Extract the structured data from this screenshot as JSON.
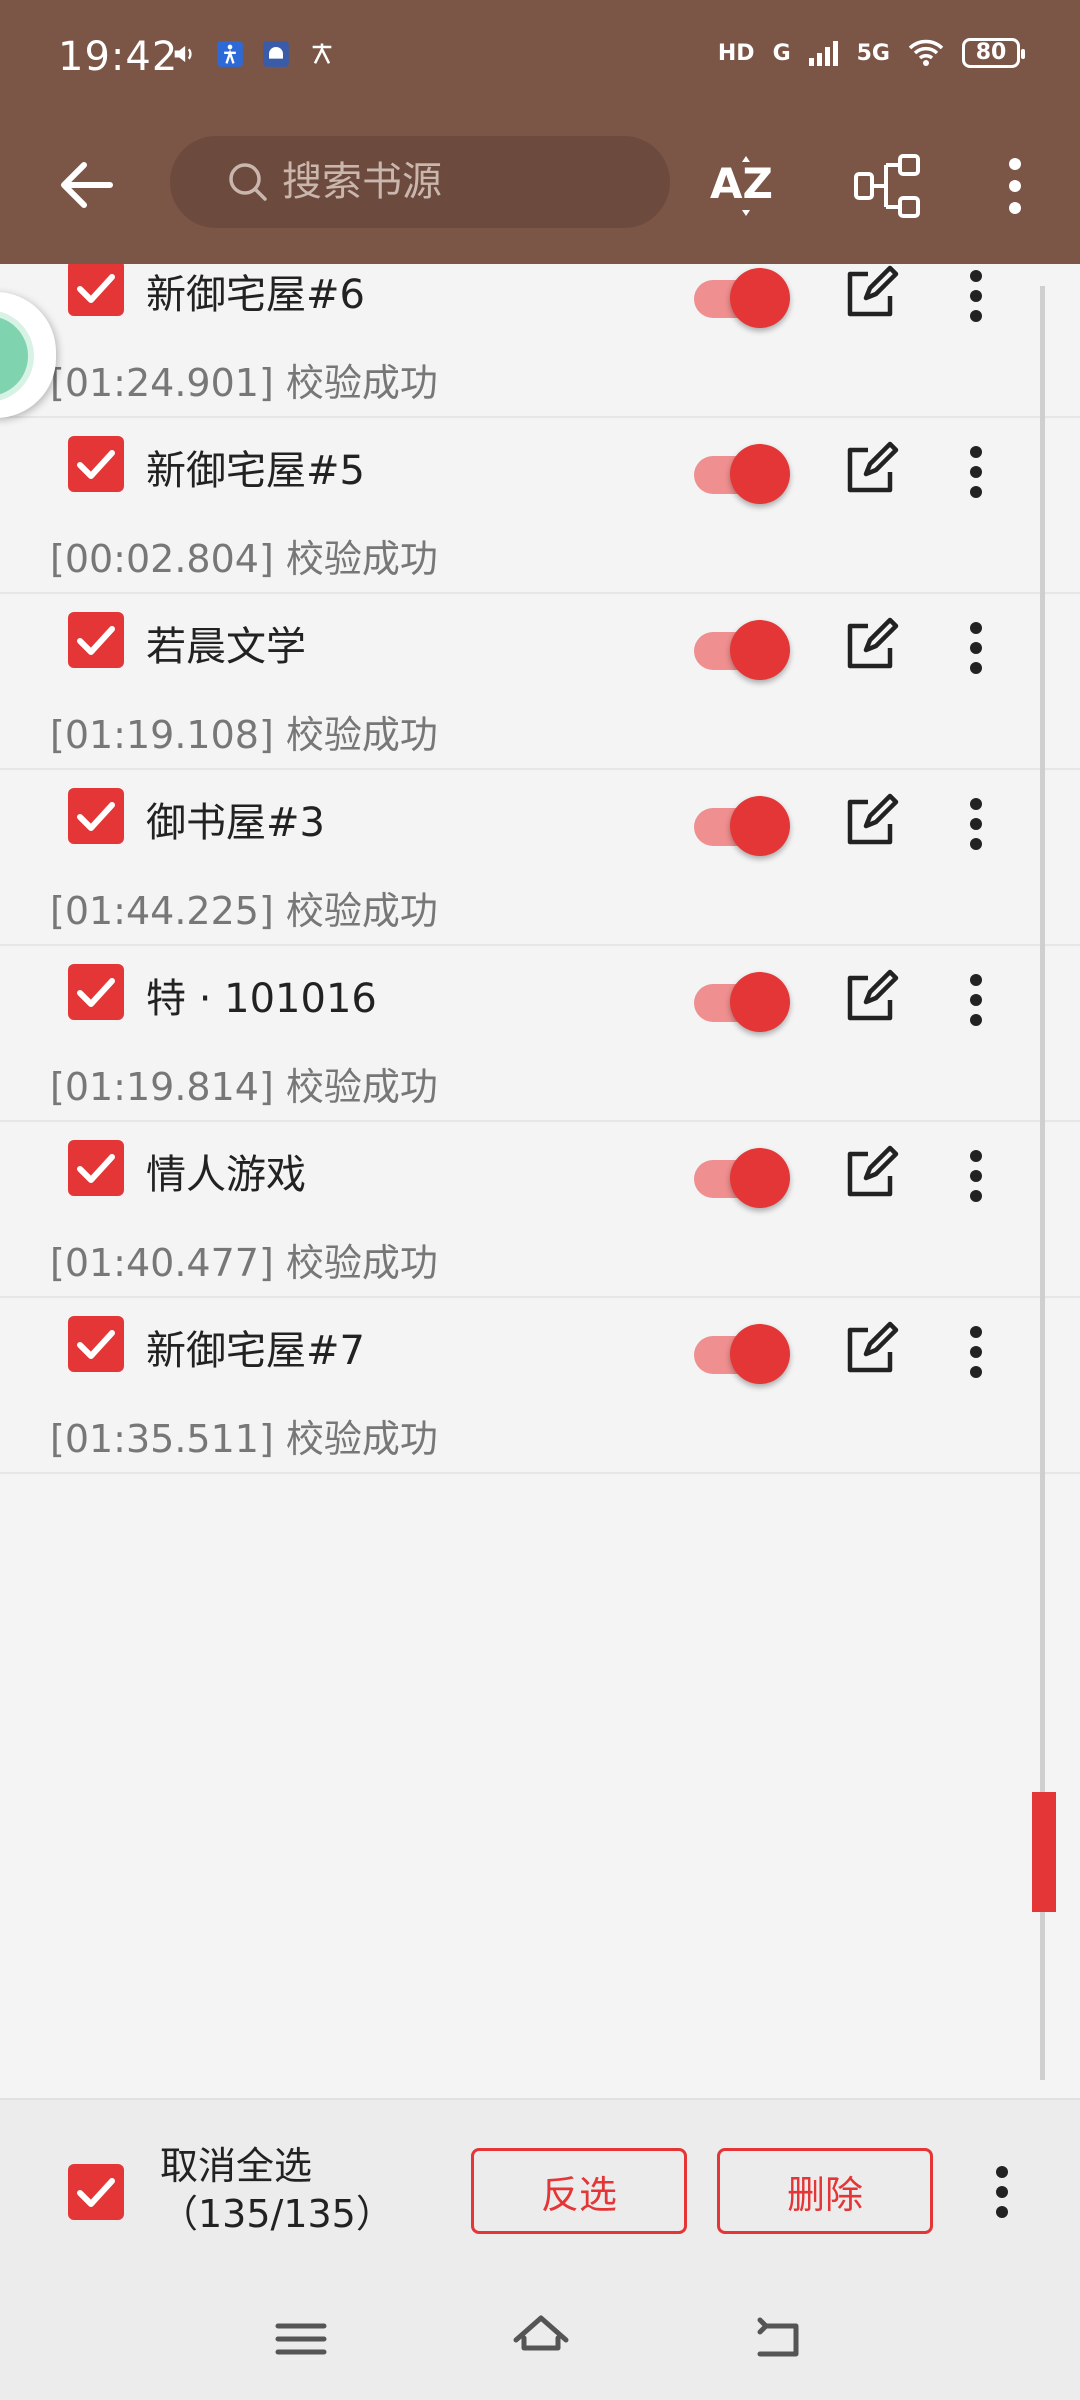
{
  "status_bar": {
    "time": "19:42",
    "network_hd": "HD",
    "network_g": "G",
    "network_5g": "5G",
    "battery": "80"
  },
  "app_bar": {
    "search_placeholder": "搜索书源"
  },
  "sources": [
    {
      "name": "新御宅屋#6",
      "status": "[01:24.901] 校验成功",
      "checked": true,
      "enabled": true
    },
    {
      "name": "新御宅屋#5",
      "status": "[00:02.804] 校验成功",
      "checked": true,
      "enabled": true
    },
    {
      "name": "若晨文学",
      "status": "[01:19.108] 校验成功",
      "checked": true,
      "enabled": true
    },
    {
      "name": "御书屋#3",
      "status": "[01:44.225] 校验成功",
      "checked": true,
      "enabled": true
    },
    {
      "name": "特 · 101016",
      "status": "[01:19.814] 校验成功",
      "checked": true,
      "enabled": true
    },
    {
      "name": " 情人游戏",
      "status": "[01:40.477] 校验成功",
      "checked": true,
      "enabled": true
    },
    {
      "name": "新御宅屋#7",
      "status": "[01:35.511] 校验成功",
      "checked": true,
      "enabled": true
    }
  ],
  "action_bar": {
    "select_label": "取消全选",
    "select_count": "（135/135）",
    "invert_label": "反选",
    "delete_label": "删除"
  },
  "colors": {
    "appbar": "#7b5546",
    "accent": "#e43636"
  }
}
